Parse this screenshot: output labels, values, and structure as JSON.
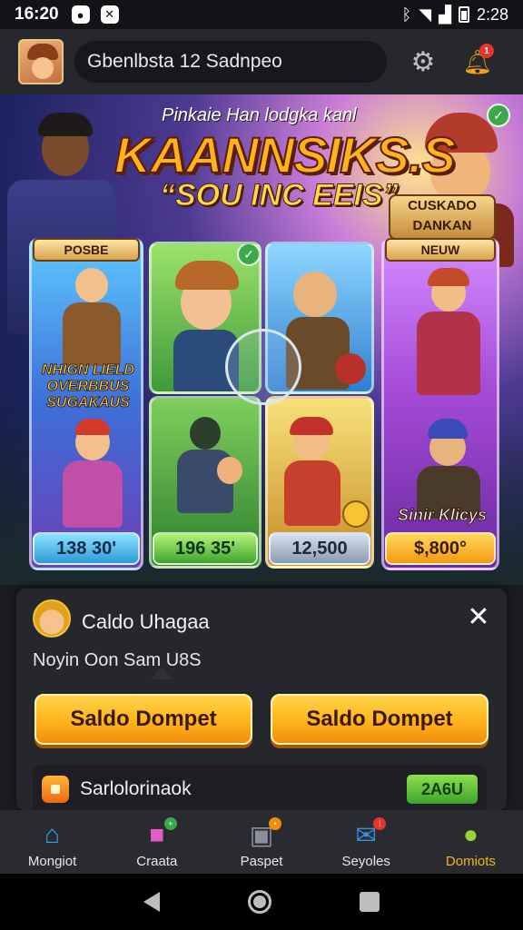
{
  "status_bar": {
    "time": "16:20",
    "right_time": "2:28",
    "icons": [
      "notification-icon",
      "x-app-icon",
      "bluetooth-icon",
      "wifi-icon",
      "signal-icon",
      "battery-icon"
    ]
  },
  "header": {
    "search_text": "Gbenlbsta 12 Sadnpeo",
    "settings_icon": "gear-icon",
    "notification_icon": "bell-icon",
    "notification_badge": "1"
  },
  "hero": {
    "subtitle": "Pinkaie Han lodgka kanl",
    "title": "KAANNSIKS.S",
    "tagline": "“SOU INC EEIS”",
    "corner_badge": "CUSKADO\nDANKAN"
  },
  "cards": {
    "blue": {
      "label": "POSBE",
      "overlay": "NHIGN LIELD\nOVERBBUS\nSUGAKAUS",
      "price": "138 30'"
    },
    "green": {
      "price": "196 35'"
    },
    "gold": {
      "price": "12,500"
    },
    "purple": {
      "label": "NEUW",
      "overlay": "Sinir Klicys",
      "price": "$,800°"
    }
  },
  "sheet": {
    "title": "Caldo Uhagaa",
    "subtitle": "Noyin Oon Sam U8S",
    "button_1": "Saldo Dompet",
    "button_2": "Saldo Dompet",
    "row_label": "Sarlolorinaok",
    "row_pill": "2A6U"
  },
  "tabs": [
    {
      "label": "Mongiot",
      "icon": "home-icon",
      "active": false
    },
    {
      "label": "Craata",
      "icon": "gift-box-icon",
      "active": false
    },
    {
      "label": "Paspet",
      "icon": "wallet-icon",
      "active": false
    },
    {
      "label": "Seyoles",
      "icon": "mail-icon",
      "active": false
    },
    {
      "label": "Domiots",
      "icon": "character-icon",
      "active": true
    }
  ],
  "colors": {
    "accent": "#f3b51c",
    "button_gold": "#ffb31c",
    "badge_red": "#e6342b",
    "sheet_bg": "#25272d"
  }
}
